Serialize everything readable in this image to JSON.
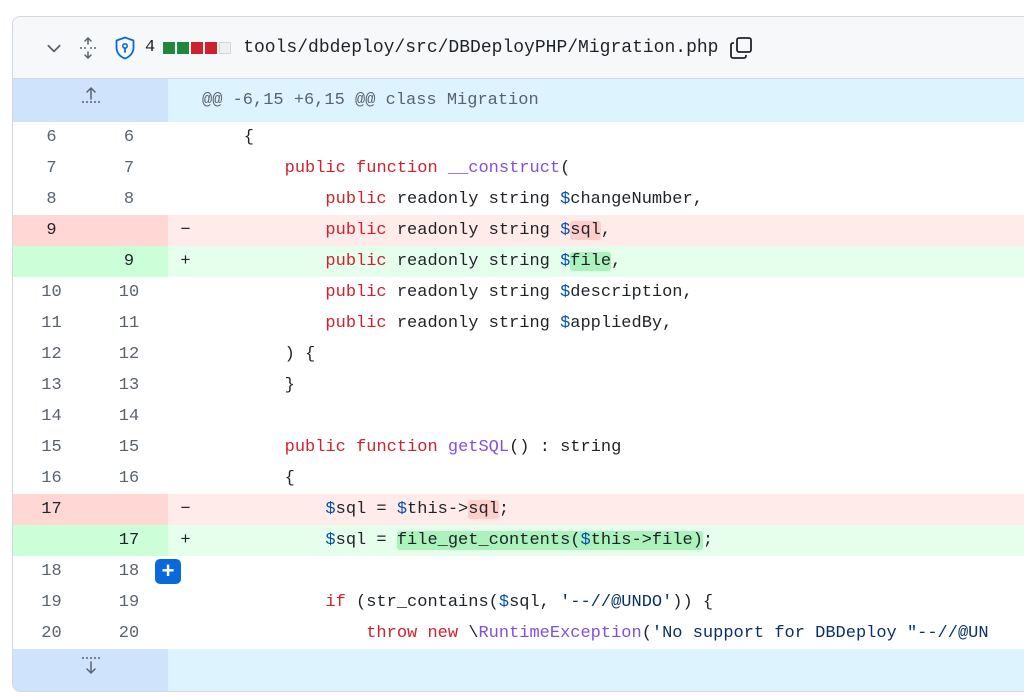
{
  "file": {
    "changes_count": "4",
    "path": "tools/dbdeploy/src/DBDeployPHP/Migration.php",
    "diffstat_colors": [
      "#1f883d",
      "#1f883d",
      "#cf222e",
      "#cf222e",
      "#f0f0f0"
    ],
    "icons": {
      "collapse": "chevron-down-icon",
      "expand_all": "expand-all-icon",
      "owner": "shield-lock-icon",
      "copy": "copy-icon",
      "expand_up": "expand-up-icon",
      "expand_down": "expand-down-icon",
      "add_comment": "plus-icon"
    }
  },
  "hunk": {
    "header": "@@ -6,15 +6,15 @@ class Migration"
  },
  "lines": [
    {
      "old": "6",
      "new": "6",
      "type": "context",
      "marker": ""
    },
    {
      "old": "7",
      "new": "7",
      "type": "context",
      "marker": ""
    },
    {
      "old": "8",
      "new": "8",
      "type": "context",
      "marker": ""
    },
    {
      "old": "9",
      "new": "",
      "type": "del",
      "marker": "−"
    },
    {
      "old": "",
      "new": "9",
      "type": "add",
      "marker": "+"
    },
    {
      "old": "10",
      "new": "10",
      "type": "context",
      "marker": ""
    },
    {
      "old": "11",
      "new": "11",
      "type": "context",
      "marker": ""
    },
    {
      "old": "12",
      "new": "12",
      "type": "context",
      "marker": ""
    },
    {
      "old": "13",
      "new": "13",
      "type": "context",
      "marker": ""
    },
    {
      "old": "14",
      "new": "14",
      "type": "context",
      "marker": ""
    },
    {
      "old": "15",
      "new": "15",
      "type": "context",
      "marker": ""
    },
    {
      "old": "16",
      "new": "16",
      "type": "context",
      "marker": ""
    },
    {
      "old": "17",
      "new": "",
      "type": "del",
      "marker": "−"
    },
    {
      "old": "",
      "new": "17",
      "type": "add",
      "marker": "+"
    },
    {
      "old": "18",
      "new": "18",
      "type": "context",
      "marker": ""
    },
    {
      "old": "19",
      "new": "19",
      "type": "context",
      "marker": ""
    },
    {
      "old": "20",
      "new": "20",
      "type": "context",
      "marker": ""
    }
  ],
  "code": {
    "l6": [
      "    {"
    ],
    "l7": [
      "        ",
      "public",
      " ",
      "function",
      " ",
      "__construct",
      "("
    ],
    "l8": [
      "            ",
      "public",
      " readonly string ",
      "$",
      "changeNumber,"
    ],
    "l9d": [
      "            ",
      "public",
      " readonly string ",
      "$",
      "sql",
      ","
    ],
    "l9a": [
      "            ",
      "public",
      " readonly string ",
      "$",
      "file",
      ","
    ],
    "l10": [
      "            ",
      "public",
      " readonly string ",
      "$",
      "description,"
    ],
    "l11": [
      "            ",
      "public",
      " readonly string ",
      "$",
      "appliedBy,"
    ],
    "l12": [
      "        ) {"
    ],
    "l13": [
      "        }"
    ],
    "l14": [
      ""
    ],
    "l15": [
      "        ",
      "public",
      " ",
      "function",
      " ",
      "getSQL",
      "() : string"
    ],
    "l16": [
      "        {"
    ],
    "l17d": [
      "            ",
      "$",
      "sql = ",
      "$",
      "this->",
      "sql",
      ";"
    ],
    "l17a": [
      "            ",
      "$",
      "sql = ",
      "file_get_contents(",
      "$",
      "this->",
      "file",
      ")",
      ";"
    ],
    "l18": [
      ""
    ],
    "l19": [
      "            ",
      "if",
      " (str_contains(",
      "$",
      "sql, ",
      "'--//@UNDO'",
      ")) {"
    ],
    "l20": [
      "                ",
      "throw",
      " ",
      "new",
      " \\",
      "RuntimeException",
      "(",
      "'No support for DBDeploy \"--//@UN"
    ]
  }
}
